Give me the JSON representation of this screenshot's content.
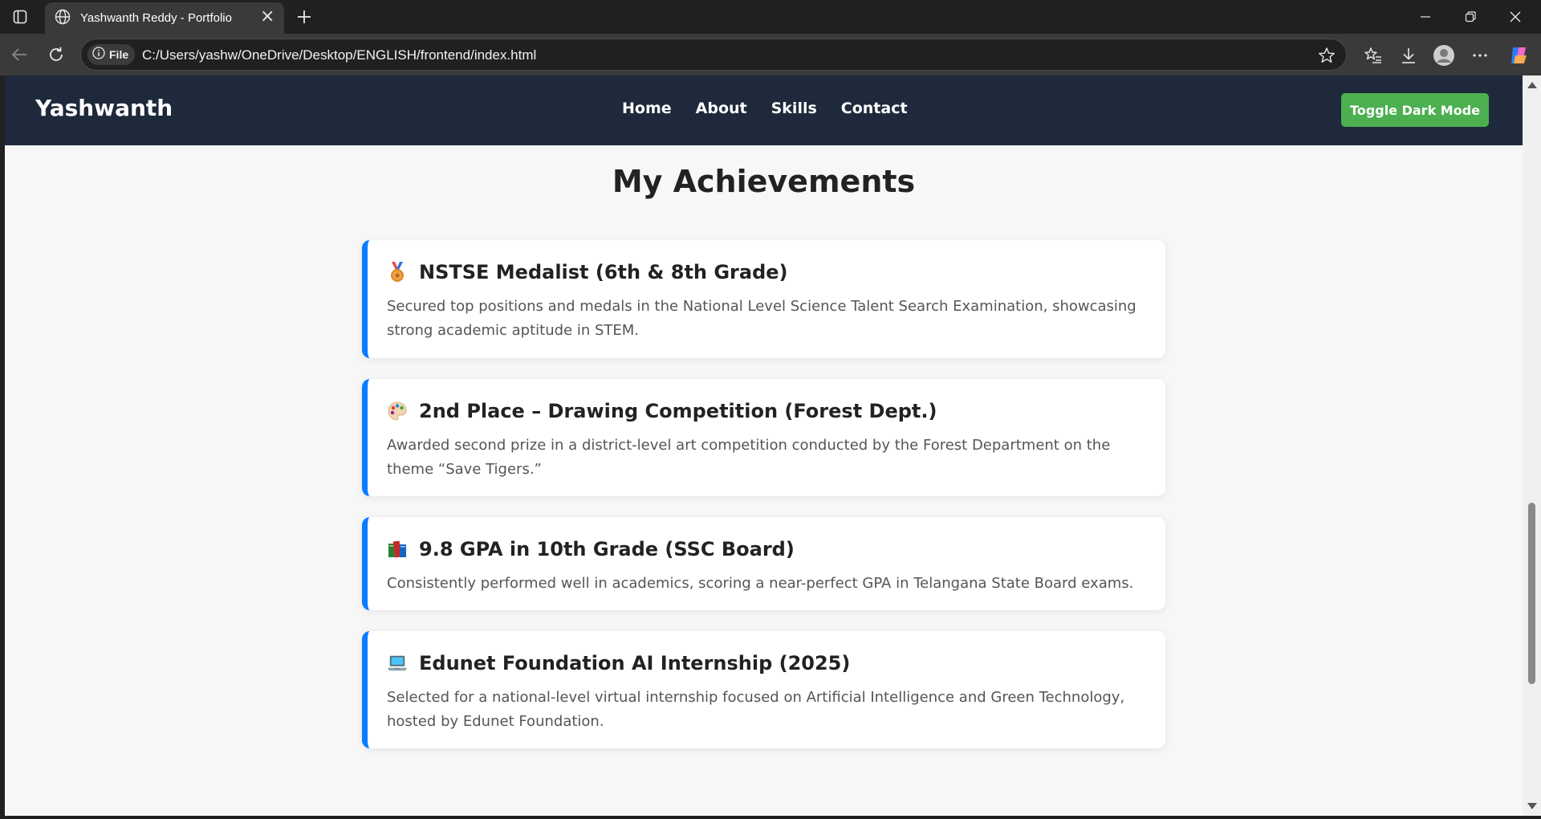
{
  "browser": {
    "tab_title": "Yashwanth Reddy - Portfolio",
    "address_chip": "File",
    "url": "C:/Users/yashw/OneDrive/Desktop/ENGLISH/frontend/index.html",
    "icons": {
      "sidebar": "sidebar-toggle-icon",
      "tab": "globe-icon",
      "close": "close-icon",
      "new_tab": "plus-icon",
      "back": "back-arrow-icon",
      "reload": "reload-icon",
      "info": "info-icon",
      "favorite": "star-icon",
      "favorites": "favorites-icon",
      "downloads": "download-icon",
      "profile": "profile-icon",
      "more": "more-icon",
      "copilot": "copilot-icon",
      "minimize": "minimize-icon",
      "restore": "restore-icon",
      "window_close": "window-close-icon"
    }
  },
  "site": {
    "brand": "Yashwanth",
    "nav": [
      "Home",
      "About",
      "Skills",
      "Contact"
    ],
    "toggle_label": "Toggle Dark Mode",
    "colors": {
      "navbar": "#1e293b",
      "toggle": "#4caf50",
      "card_accent": "#0a7cff",
      "page_bg": "#f7f7f7"
    }
  },
  "achievements": {
    "title": "My Achievements",
    "items": [
      {
        "icon": "medal-icon",
        "title": "NSTSE Medalist (6th & 8th Grade)",
        "description": "Secured top positions and medals in the National Level Science Talent Search Examination, showcasing strong academic aptitude in STEM."
      },
      {
        "icon": "palette-icon",
        "title": "2nd Place – Drawing Competition (Forest Dept.)",
        "description": "Awarded second prize in a district-level art competition conducted by the Forest Department on the theme “Save Tigers.”"
      },
      {
        "icon": "books-icon",
        "title": "9.8 GPA in 10th Grade (SSC Board)",
        "description": "Consistently performed well in academics, scoring a near-perfect GPA in Telangana State Board exams."
      },
      {
        "icon": "laptop-icon",
        "title": "Edunet Foundation AI Internship (2025)",
        "description": "Selected for a national-level virtual internship focused on Artificial Intelligence and Green Technology, hosted by Edunet Foundation."
      }
    ]
  }
}
